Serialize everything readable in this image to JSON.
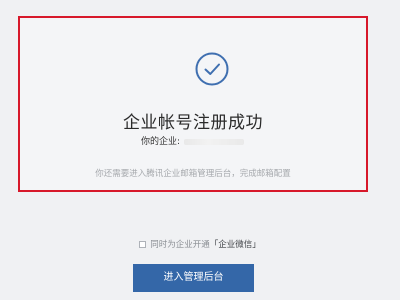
{
  "success_card": {
    "icon": "check-circle-icon",
    "title": "企业帐号注册成功",
    "company_label": "你的企业:",
    "company_value": "",
    "hint": "你还需要进入腾讯企业邮箱管理后台，完成邮箱配置"
  },
  "option": {
    "prefix": "同时为企业开通",
    "highlight": "「企业微信」",
    "checked": false
  },
  "primary_button": {
    "label": "进入管理后台"
  },
  "colors": {
    "accent": "#3467a8",
    "highlight_border": "#d7182a",
    "icon": "#3f6fb0"
  }
}
